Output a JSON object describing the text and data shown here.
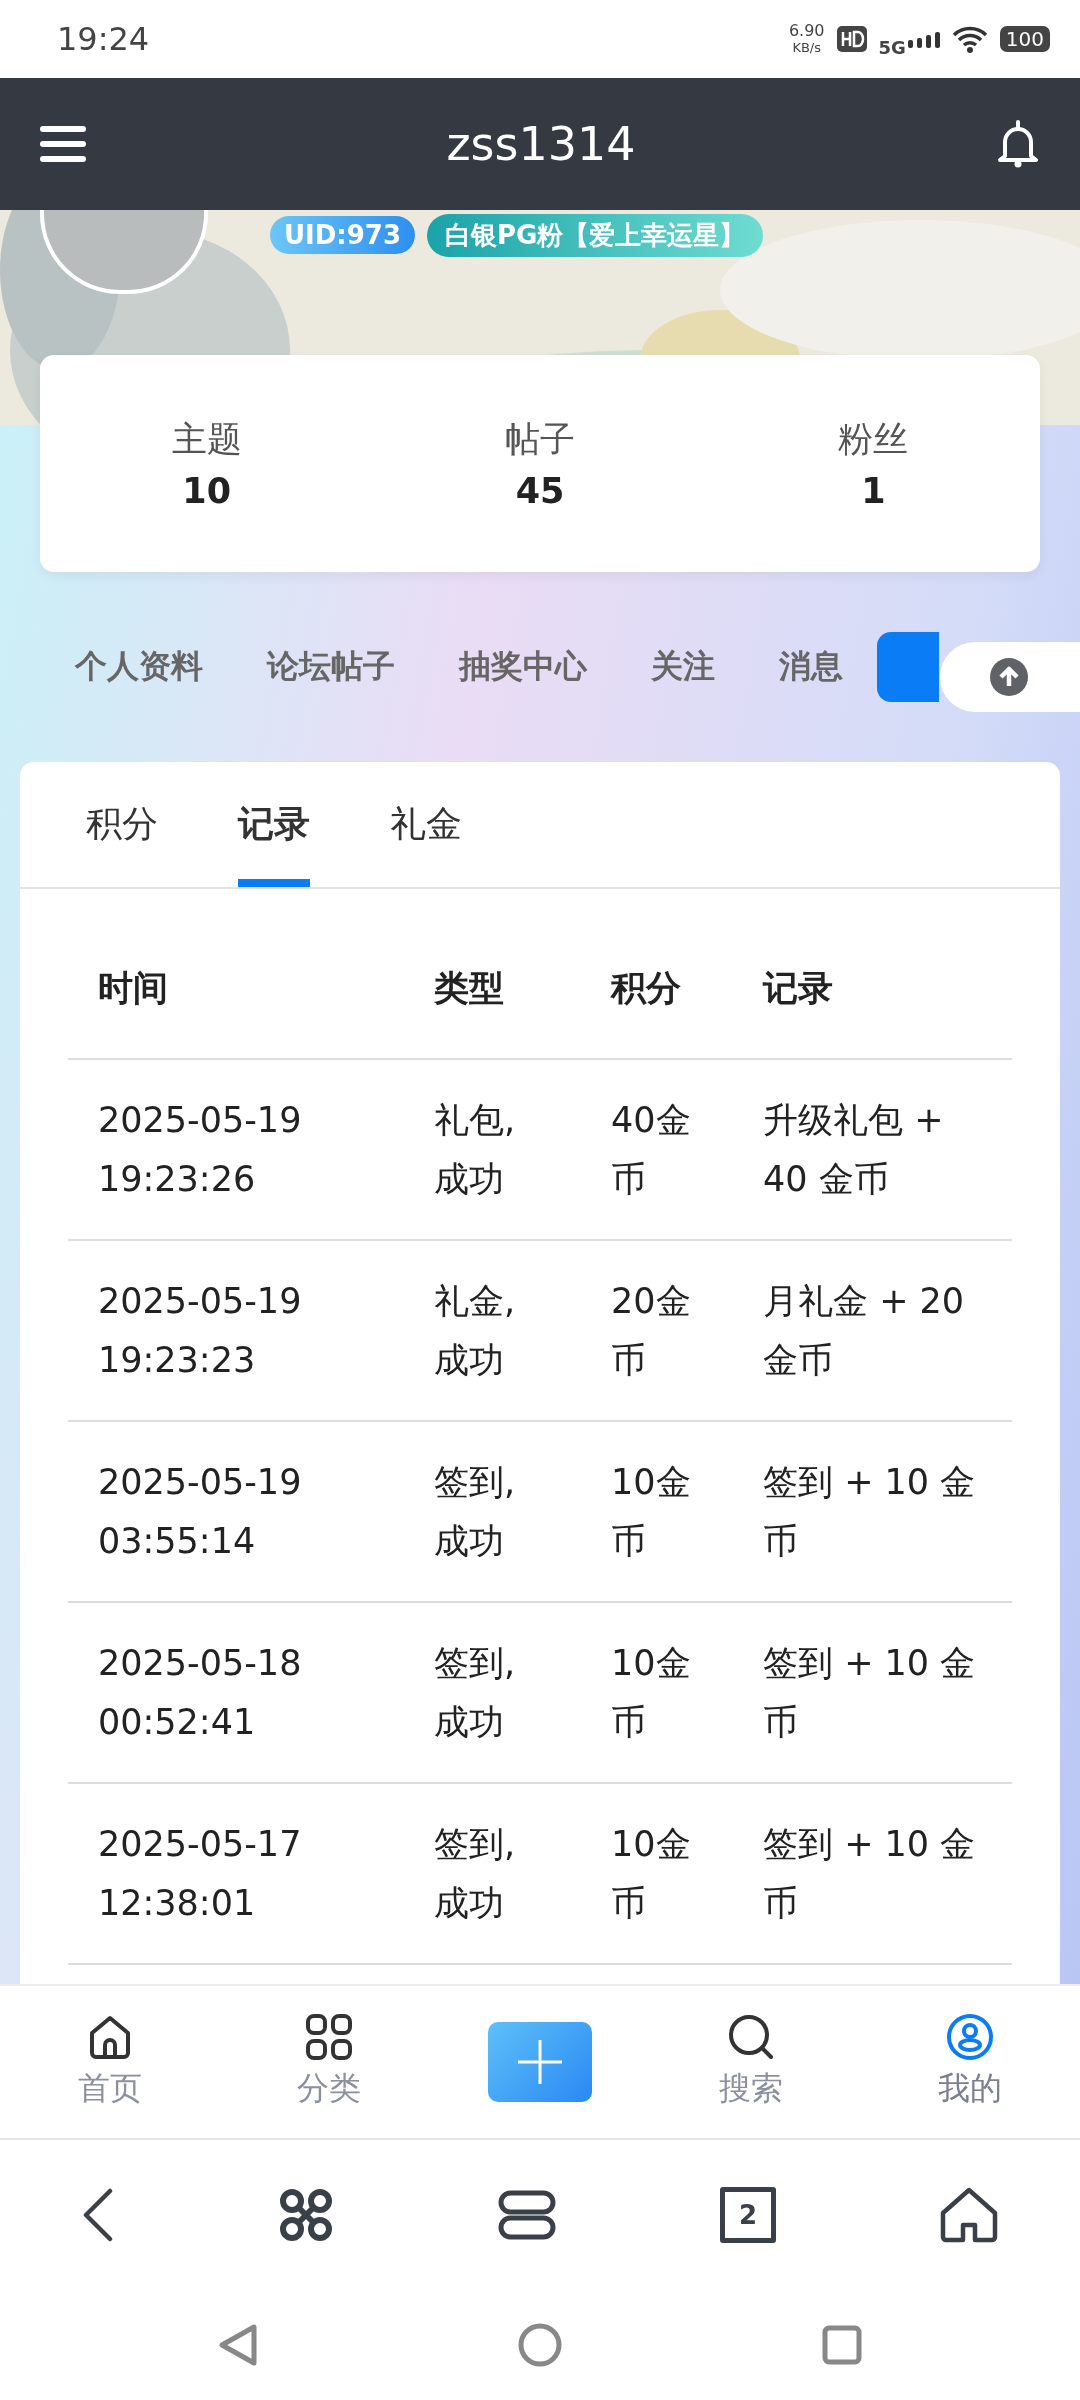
{
  "status_bar": {
    "time": "19:24",
    "speed": "6.90",
    "speed_unit": "KB/s",
    "network": "5G",
    "battery": "100"
  },
  "header": {
    "title": "zss1314"
  },
  "profile": {
    "uid": "UID:973",
    "rank": "白银PG粉【爱上幸运星】"
  },
  "stats": [
    {
      "label": "主题",
      "value": "10"
    },
    {
      "label": "帖子",
      "value": "45"
    },
    {
      "label": "粉丝",
      "value": "1"
    }
  ],
  "profile_tabs": [
    {
      "label": "个人资料"
    },
    {
      "label": "论坛帖子"
    },
    {
      "label": "抽奖中心"
    },
    {
      "label": "关注"
    },
    {
      "label": "消息"
    }
  ],
  "record_tabs": [
    {
      "label": "积分",
      "selected": false
    },
    {
      "label": "记录",
      "selected": true
    },
    {
      "label": "礼金",
      "selected": false
    }
  ],
  "table": {
    "columns": [
      "时间",
      "类型",
      "积分",
      "记录"
    ],
    "rows": [
      [
        "2025-05-19 19:23:26",
        "礼包,成功",
        "40金币",
        "升级礼包 + 40 金币"
      ],
      [
        "2025-05-19 19:23:23",
        "礼金,成功",
        "20金币",
        "月礼金 + 20 金币"
      ],
      [
        "2025-05-19 03:55:14",
        "签到,成功",
        "10金币",
        "签到 + 10 金币"
      ],
      [
        "2025-05-18 00:52:41",
        "签到,成功",
        "10金币",
        "签到 + 10 金币"
      ],
      [
        "2025-05-17 12:38:01",
        "签到,成功",
        "10金币",
        "签到 + 10 金币"
      ]
    ]
  },
  "bottom_nav": [
    {
      "kind": "home",
      "label": "首页",
      "selected": false
    },
    {
      "kind": "grid",
      "label": "分类",
      "selected": false
    },
    {
      "kind": "add"
    },
    {
      "kind": "search",
      "label": "搜索",
      "selected": false
    },
    {
      "kind": "user",
      "label": "我的",
      "selected": true
    }
  ],
  "browser_bar": {
    "tab_count": "2"
  }
}
